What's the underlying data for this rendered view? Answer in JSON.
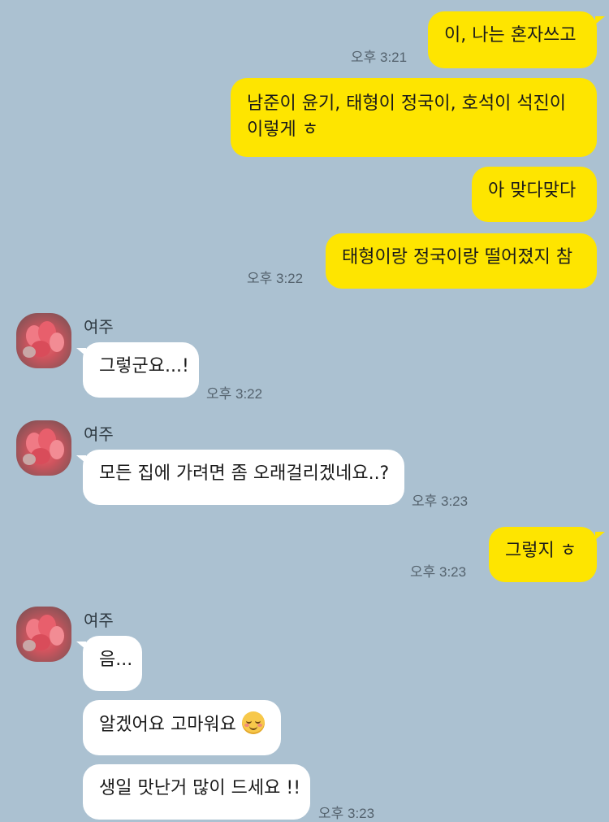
{
  "messages": {
    "m1": {
      "text": "이, 나는 혼자쓰고",
      "time": "오후 3:21"
    },
    "m2": {
      "line1": "남준이 윤기, 태형이 정국이, 호석이 석진이",
      "line2": "이렇게 ㅎ"
    },
    "m3": {
      "text": "아 맞다맞다"
    },
    "m4": {
      "text": "태형이랑 정국이랑 떨어졌지 참",
      "time": "오후 3:22"
    },
    "m5": {
      "sender": "여주",
      "text": "그렇군요...!",
      "time": "오후 3:22"
    },
    "m6": {
      "sender": "여주",
      "text": "모든 집에 가려면 좀 오래걸리겠네요..?",
      "time": "오후 3:23"
    },
    "m7": {
      "text": "그렇지 ㅎ",
      "time": "오후 3:23"
    },
    "m8": {
      "sender": "여주",
      "text": "음..."
    },
    "m9": {
      "text": "알겠어요 고마워요",
      "emoji": "smiling-face-icon"
    },
    "m10": {
      "text": "생일 맛난거 많이 드세요 !!",
      "time": "오후 3:23"
    }
  },
  "colors": {
    "background": "#abc1d1",
    "outgoing_bubble": "#fee500",
    "incoming_bubble": "#ffffff",
    "timestamp": "#54626d"
  }
}
